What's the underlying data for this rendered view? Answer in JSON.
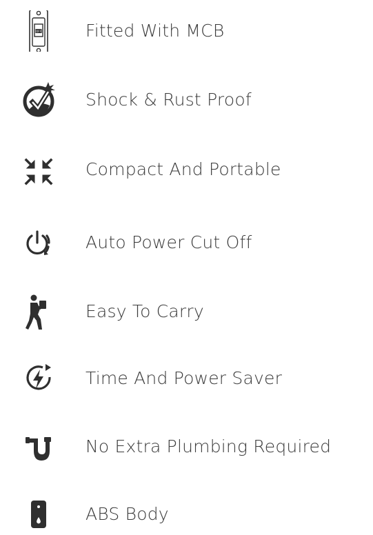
{
  "features": [
    {
      "label": "Fitted With MCB",
      "icon": "mcb-switch-icon"
    },
    {
      "label": "Shock & Rust Proof",
      "icon": "shock-proof-check-icon"
    },
    {
      "label": "Compact And Portable",
      "icon": "compress-arrows-icon"
    },
    {
      "label": "Auto Power Cut Off",
      "icon": "power-cycle-icon"
    },
    {
      "label": "Easy To Carry",
      "icon": "person-carrying-icon"
    },
    {
      "label": "Time And Power Saver",
      "icon": "lightning-refresh-icon"
    },
    {
      "label": "No Extra Plumbing Required",
      "icon": "plumbing-pipe-icon"
    },
    {
      "label": "ABS Body",
      "icon": "water-heater-body-icon"
    }
  ],
  "colors": {
    "text": "#3a3a3a",
    "icon": "#2f2f2f",
    "background": "#ffffff"
  }
}
